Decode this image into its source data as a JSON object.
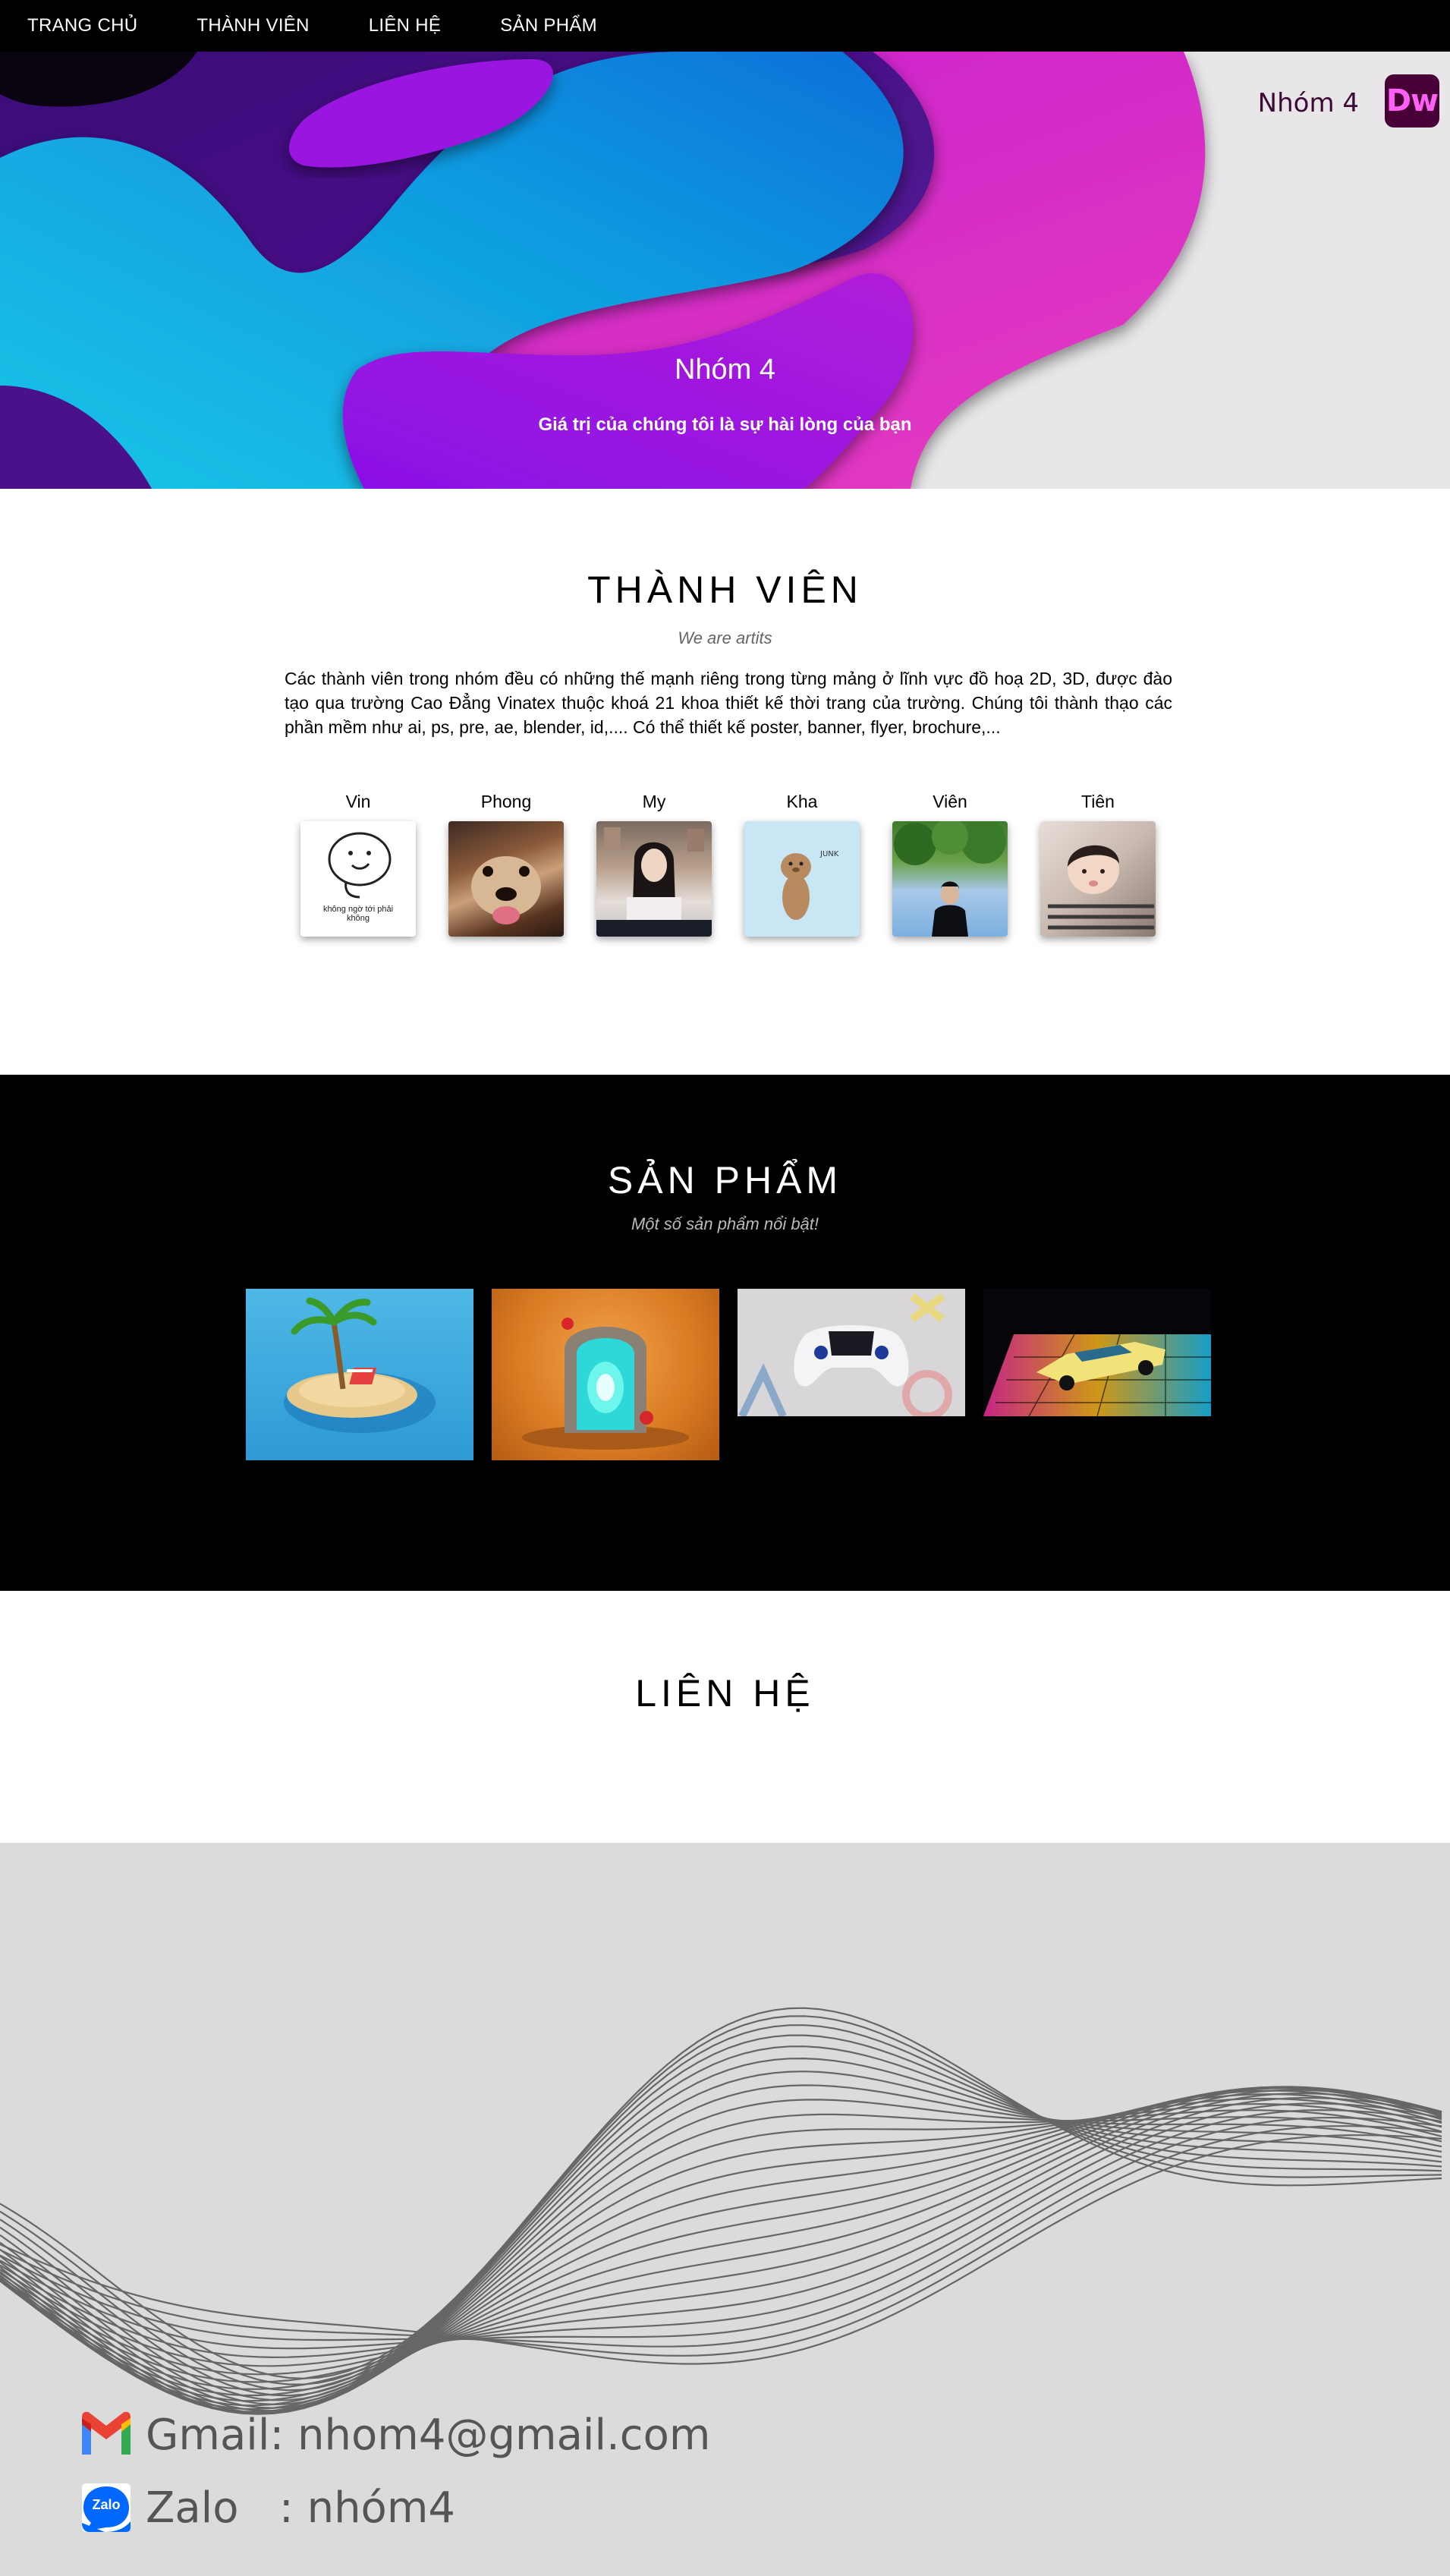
{
  "nav": {
    "items": [
      "TRANG CHỦ",
      "THÀNH VIÊN",
      "LIÊN HỆ",
      "SẢN PHẨM"
    ]
  },
  "hero": {
    "brand": "Nhóm 4",
    "logo_text": "Dw",
    "title": "Nhóm 4",
    "subtitle": "Giá trị của chúng tôi là sự hài lòng của bạn"
  },
  "members": {
    "title": "THÀNH VIÊN",
    "subtitle": "We are artits",
    "description": "Các thành viên trong nhóm đều có những thế mạnh riêng trong từng mảng ở lĩnh vực đồ hoạ 2D, 3D, được đào tạo qua trường Cao Đẳng Vinatex thuộc khoá 21 khoa thiết kế thời trang của trường. Chúng tôi thành thạo các phần mềm như ai, ps, pre, ae, blender, id,.... Có thể thiết kế poster, banner, flyer, brochure,...",
    "people": [
      {
        "name": "Vin",
        "caption": "không ngờ tới phải không"
      },
      {
        "name": "Phong"
      },
      {
        "name": "My"
      },
      {
        "name": "Kha"
      },
      {
        "name": "Viên"
      },
      {
        "name": "Tiên"
      }
    ]
  },
  "products": {
    "title": "SẢN PHẨM",
    "subtitle": "Một số sản phẩm nổi bật!",
    "items": [
      "island-render",
      "portal-render",
      "gamepad-render",
      "car-render"
    ]
  },
  "contact": {
    "title": "LIÊN HỆ",
    "gmail": "Gmail: nhom4@gmail.com",
    "zalo": "Zalo   : nhóm4",
    "zalo_icon_text": "Zalo"
  },
  "colors": {
    "nav_bg": "#000000",
    "dw_bg": "#470137",
    "dw_text": "#ff61f6",
    "footer_bg": "#dcdbdc"
  }
}
